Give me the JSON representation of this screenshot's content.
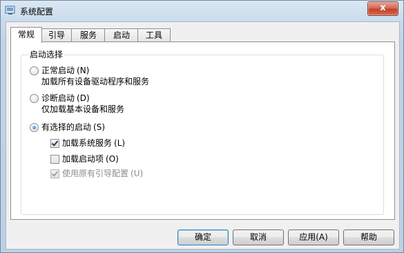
{
  "window": {
    "title": "系统配置",
    "close_label": "x"
  },
  "tabs": [
    {
      "label": "常规",
      "active": true
    },
    {
      "label": "引导",
      "active": false
    },
    {
      "label": "服务",
      "active": false
    },
    {
      "label": "启动",
      "active": false
    },
    {
      "label": "工具",
      "active": false
    }
  ],
  "startup_selection": {
    "group_label": "启动选择",
    "options": [
      {
        "label": "正常启动",
        "hotkey": "(N)",
        "description": "加载所有设备驱动程序和服务",
        "selected": false
      },
      {
        "label": "诊断启动",
        "hotkey": "(D)",
        "description": "仅加载基本设备和服务",
        "selected": false
      },
      {
        "label": "有选择的启动",
        "hotkey": "(S)",
        "selected": true
      }
    ],
    "checkboxes": [
      {
        "label": "加载系统服务",
        "hotkey": "(L)",
        "checked": true,
        "enabled": true
      },
      {
        "label": "加载启动项",
        "hotkey": "(O)",
        "checked": false,
        "enabled": true,
        "highlighted": true
      },
      {
        "label": "使用原有引导配置",
        "hotkey": "(U)",
        "checked": true,
        "enabled": false
      }
    ]
  },
  "buttons": {
    "ok": "确定",
    "cancel": "取消",
    "apply": "应用(A)",
    "help": "帮助"
  },
  "colors": {
    "highlight_border": "#e0232b",
    "window_frame": "#bcd1e5",
    "close_button": "#c0402b"
  }
}
